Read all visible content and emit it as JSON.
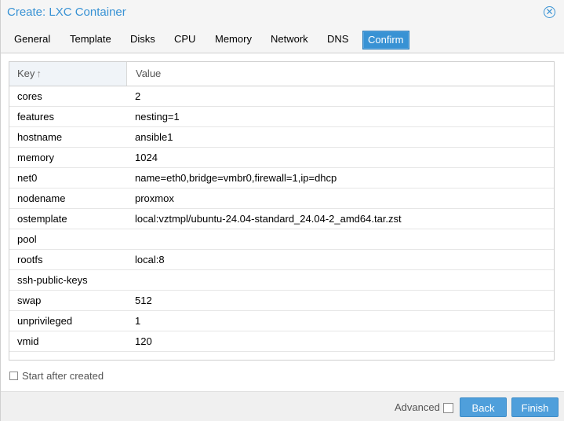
{
  "window": {
    "title": "Create: LXC Container"
  },
  "tabs": [
    {
      "label": "General"
    },
    {
      "label": "Template"
    },
    {
      "label": "Disks"
    },
    {
      "label": "CPU"
    },
    {
      "label": "Memory"
    },
    {
      "label": "Network"
    },
    {
      "label": "DNS"
    },
    {
      "label": "Confirm",
      "active": true
    }
  ],
  "grid": {
    "columns": {
      "key": "Key",
      "value": "Value"
    },
    "sort_icon": "arrow-up-icon",
    "rows": [
      {
        "key": "cores",
        "value": "2"
      },
      {
        "key": "features",
        "value": "nesting=1"
      },
      {
        "key": "hostname",
        "value": "ansible1"
      },
      {
        "key": "memory",
        "value": "1024"
      },
      {
        "key": "net0",
        "value": "name=eth0,bridge=vmbr0,firewall=1,ip=dhcp"
      },
      {
        "key": "nodename",
        "value": "proxmox"
      },
      {
        "key": "ostemplate",
        "value": "local:vztmpl/ubuntu-24.04-standard_24.04-2_amd64.tar.zst"
      },
      {
        "key": "pool",
        "value": ""
      },
      {
        "key": "rootfs",
        "value": "local:8"
      },
      {
        "key": "ssh-public-keys",
        "value": ""
      },
      {
        "key": "swap",
        "value": "512"
      },
      {
        "key": "unprivileged",
        "value": "1"
      },
      {
        "key": "vmid",
        "value": "120"
      }
    ]
  },
  "start_after_created": {
    "label": "Start after created",
    "checked": false
  },
  "footer": {
    "advanced_label": "Advanced",
    "advanced_checked": false,
    "back_label": "Back",
    "finish_label": "Finish"
  },
  "colors": {
    "accent": "#3892d4",
    "button": "#4f9fdb"
  }
}
